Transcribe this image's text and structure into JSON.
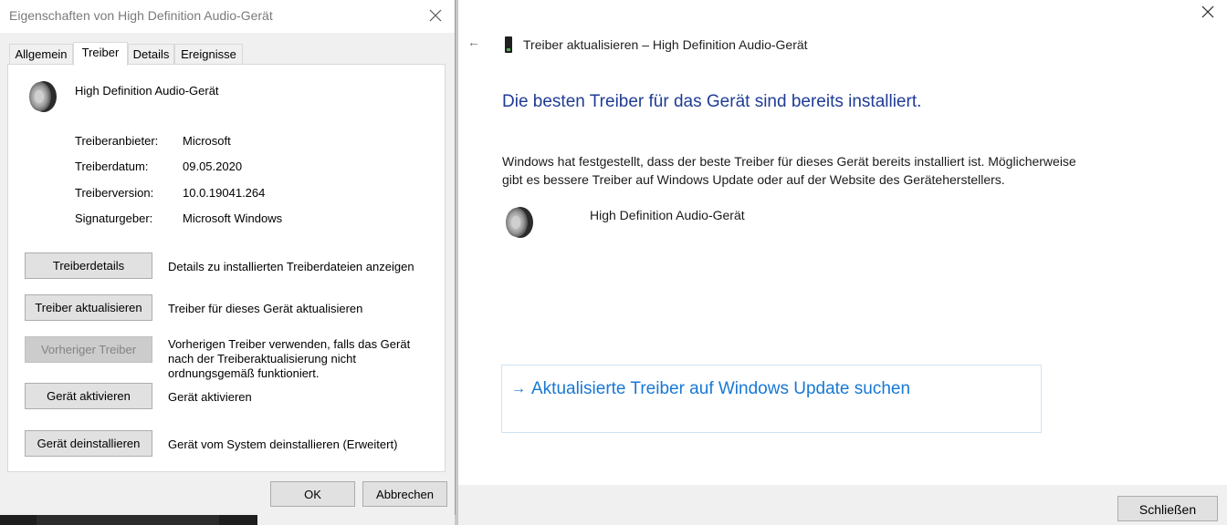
{
  "left": {
    "window_title": "Eigenschaften von High Definition Audio-Gerät",
    "tabs": [
      "Allgemein",
      "Treiber",
      "Details",
      "Ereignisse"
    ],
    "active_tab": "Treiber",
    "device_name": "High Definition Audio-Gerät",
    "properties": [
      {
        "label": "Treiberanbieter:",
        "value": "Microsoft"
      },
      {
        "label": "Treiberdatum:",
        "value": "09.05.2020"
      },
      {
        "label": "Treiberversion:",
        "value": "10.0.19041.264"
      },
      {
        "label": "Signaturgeber:",
        "value": "Microsoft Windows"
      }
    ],
    "actions": [
      {
        "button": "Treiberdetails",
        "description": "Details zu installierten Treiberdateien anzeigen",
        "enabled": true
      },
      {
        "button": "Treiber aktualisieren",
        "description": "Treiber für dieses Gerät aktualisieren",
        "enabled": true
      },
      {
        "button": "Vorheriger Treiber",
        "description_lines": [
          "Vorherigen Treiber verwenden, falls das Gerät",
          "nach der Treiberaktualisierung nicht",
          "ordnungsgemäß funktioniert."
        ],
        "enabled": false
      },
      {
        "button": "Gerät aktivieren",
        "description": "Gerät aktivieren",
        "enabled": true
      },
      {
        "button": "Gerät deinstallieren",
        "description": "Gerät vom System deinstallieren (Erweitert)",
        "enabled": true
      }
    ],
    "ok_label": "OK",
    "cancel_label": "Abbrechen",
    "icons": {
      "device": "speaker-icon",
      "close": "close-icon"
    }
  },
  "right": {
    "wizard_title": "Treiber aktualisieren – High Definition Audio-Gerät",
    "back_icon": "back-arrow-icon",
    "heading": "Die besten Treiber für das Gerät sind bereits installiert.",
    "info_lines": [
      "Windows hat festgestellt, dass der beste Treiber für dieses Gerät bereits installiert ist. Möglicherweise",
      "gibt es bessere Treiber auf Windows Update oder auf der Website des Geräteherstellers."
    ],
    "device_name": "High Definition Audio-Gerät",
    "update_link": "Aktualisierte Treiber auf Windows Update suchen",
    "close_label": "Schließen",
    "colors": {
      "heading": "#1f3c95",
      "link": "#1878d4"
    }
  }
}
